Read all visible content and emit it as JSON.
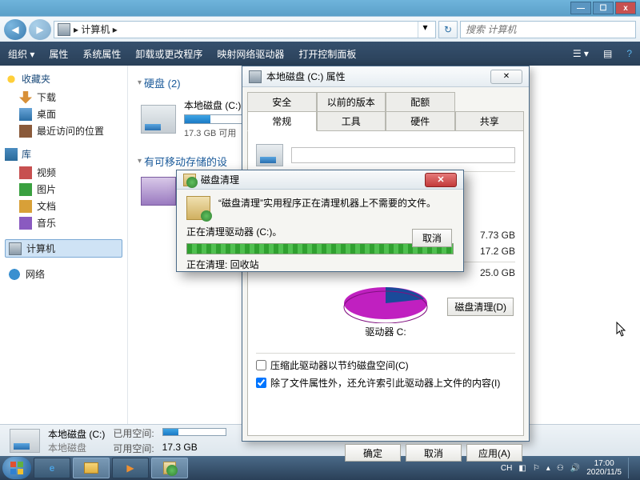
{
  "window": {
    "min": "—",
    "max": "☐",
    "close": "x"
  },
  "nav": {
    "back": "◀",
    "fwd": "▶",
    "crumb_root": "计算机",
    "crumb_sep": "▸",
    "search_ph": "搜索 计算机"
  },
  "toolbar": {
    "organize": "组织 ▾",
    "properties": "属性",
    "sysprops": "系统属性",
    "uninstall": "卸载或更改程序",
    "mapdrive": "映射网络驱动器",
    "ctrlpanel": "打开控制面板"
  },
  "sidebar": {
    "fav": "收藏夹",
    "downloads": "下载",
    "desktop": "桌面",
    "recent": "最近访问的位置",
    "libs": "库",
    "videos": "视频",
    "pictures": "图片",
    "documents": "文档",
    "music": "音乐",
    "computer": "计算机",
    "network": "网络"
  },
  "content": {
    "hdd_group": "硬盘 (2)",
    "removable_group": "有可移动存储的设",
    "drive_c": {
      "name": "本地磁盘 (C:)",
      "free_text": "17.3 GB 可用",
      "fill_pct": 25
    }
  },
  "status": {
    "title": "本地磁盘 (C:)",
    "subtitle": "本地磁盘",
    "used_k": "已用空间:",
    "free_k": "可用空间:",
    "free_v": "17.3 GB"
  },
  "prop": {
    "title": "本地磁盘 (C:) 属性",
    "tabs_top": [
      "安全",
      "以前的版本",
      "配额"
    ],
    "tabs_bottom": [
      "常规",
      "工具",
      "硬件",
      "共享"
    ],
    "used_size": "7.73 GB",
    "free_size": "17.2 GB",
    "total_size": "25.0 GB",
    "drive_label": "驱动器 C:",
    "cleanup": "磁盘清理(D)",
    "chk1": "压缩此驱动器以节约磁盘空间(C)",
    "chk2": "除了文件属性外，还允许索引此驱动器上文件的内容(I)",
    "ok": "确定",
    "cancel": "取消",
    "apply": "应用(A)",
    "close": "✕"
  },
  "clean": {
    "title": "磁盘清理",
    "msg": "“磁盘清理”实用程序正在清理机器上不需要的文件。",
    "line1": "正在清理驱动器   (C:)。",
    "line2": "正在清理: 回收站",
    "cancel": "取消",
    "close": "✕"
  },
  "taskbar": {
    "ime": "CH",
    "time": "17:00",
    "date": "2020/11/5"
  }
}
